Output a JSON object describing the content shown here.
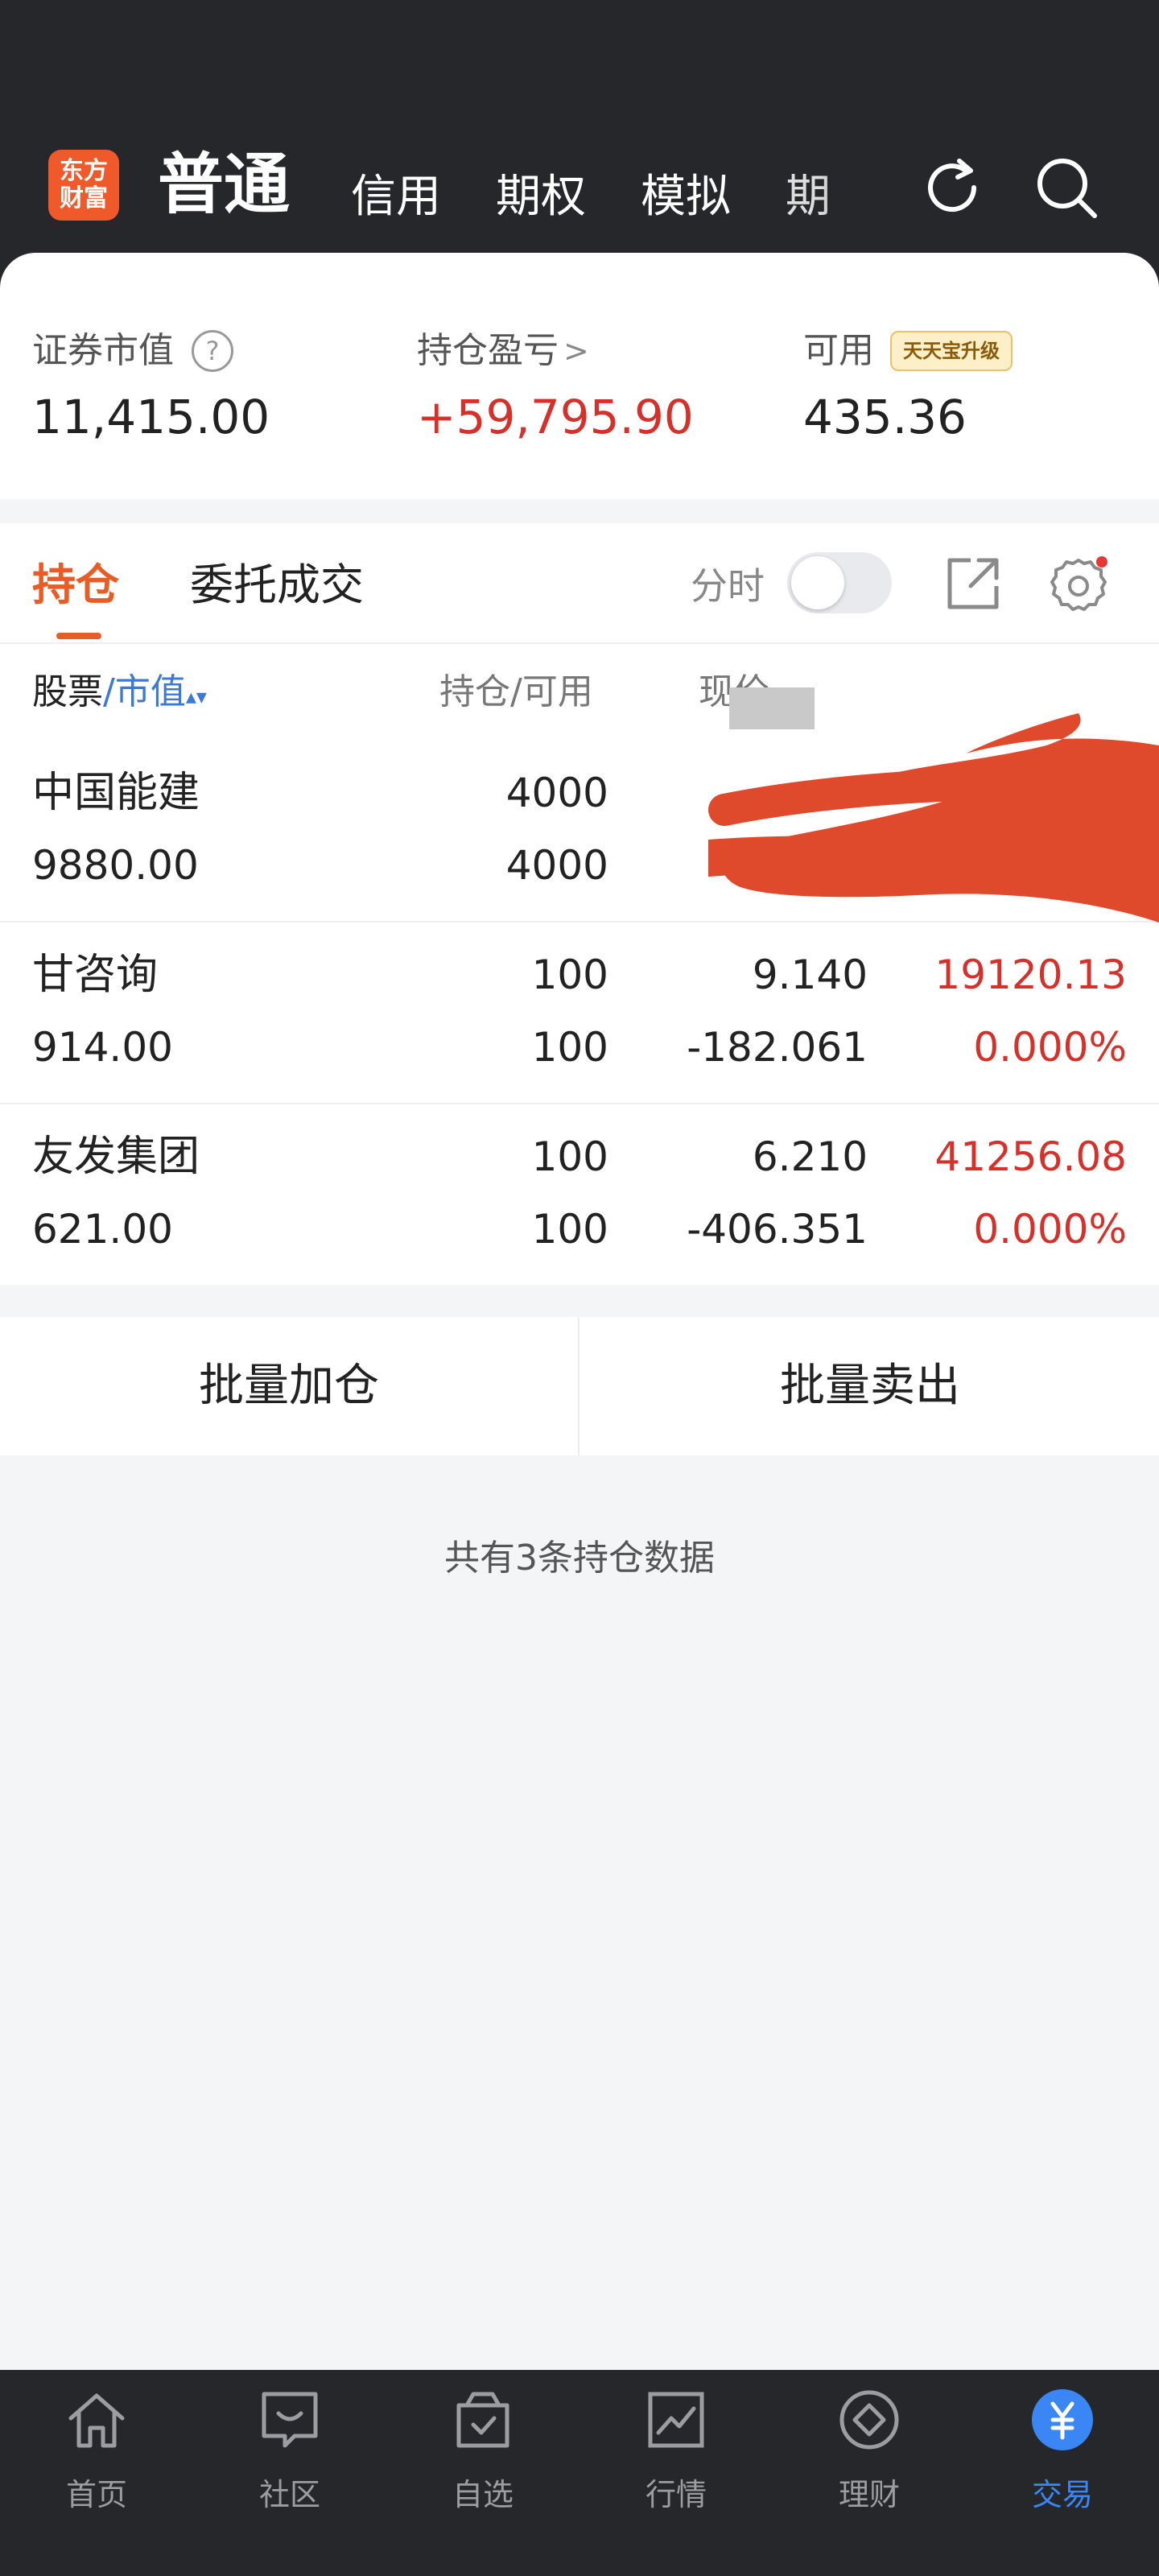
{
  "colors": {
    "accent": "#e85d26",
    "gain": "#d6302b",
    "link": "#3c78d8",
    "nav_active": "#3a86f4",
    "header_bg": "#25272b"
  },
  "header": {
    "logo_line1": "东方",
    "logo_line2": "财富",
    "active_tab": "普通",
    "tabs": [
      "信用",
      "期权",
      "模拟",
      "期"
    ],
    "refresh_icon": "refresh-icon",
    "search_icon": "search-icon"
  },
  "summary": {
    "market_value_label": "证券市值",
    "market_value": "11,415.00",
    "help": "?",
    "pl_label": "持仓盈亏",
    "pl_chevron": ">",
    "pl_value": "+59,795.90",
    "avail_label": "可用",
    "avail_badge": "天天宝升级",
    "avail_value": "435.36"
  },
  "holdings": {
    "tabs": [
      "持仓",
      "委托成交"
    ],
    "fenshi_label": "分时",
    "fenshi_on": false,
    "columns": {
      "stock": "股票",
      "sep": "/",
      "market_value": "市值",
      "sort": "▴▾",
      "position": "持仓/可用",
      "price": "现价"
    },
    "rows": [
      {
        "name": "中国能建",
        "market_value": "9880.00",
        "position": "4000",
        "available": "4000",
        "price": "",
        "cost": "",
        "pl": "",
        "pl_ratio": ""
      },
      {
        "name": "甘咨询",
        "market_value": "914.00",
        "position": "100",
        "available": "100",
        "price": "9.140",
        "cost": "-182.061",
        "pl": "19120.13",
        "pl_ratio": "0.000%"
      },
      {
        "name": "友发集团",
        "market_value": "621.00",
        "position": "100",
        "available": "100",
        "price": "6.210",
        "cost": "-406.351",
        "pl": "41256.08",
        "pl_ratio": "0.000%"
      }
    ]
  },
  "actions": {
    "batch_add": "批量加仓",
    "batch_sell": "批量卖出"
  },
  "count_note": "共有3条持仓数据",
  "bottom_nav": [
    {
      "label": "首页",
      "icon": "home-icon"
    },
    {
      "label": "社区",
      "icon": "community-icon"
    },
    {
      "label": "自选",
      "icon": "watchlist-icon"
    },
    {
      "label": "行情",
      "icon": "market-icon"
    },
    {
      "label": "理财",
      "icon": "wealth-icon"
    },
    {
      "label": "交易",
      "icon": "trade-icon",
      "active": true
    }
  ]
}
